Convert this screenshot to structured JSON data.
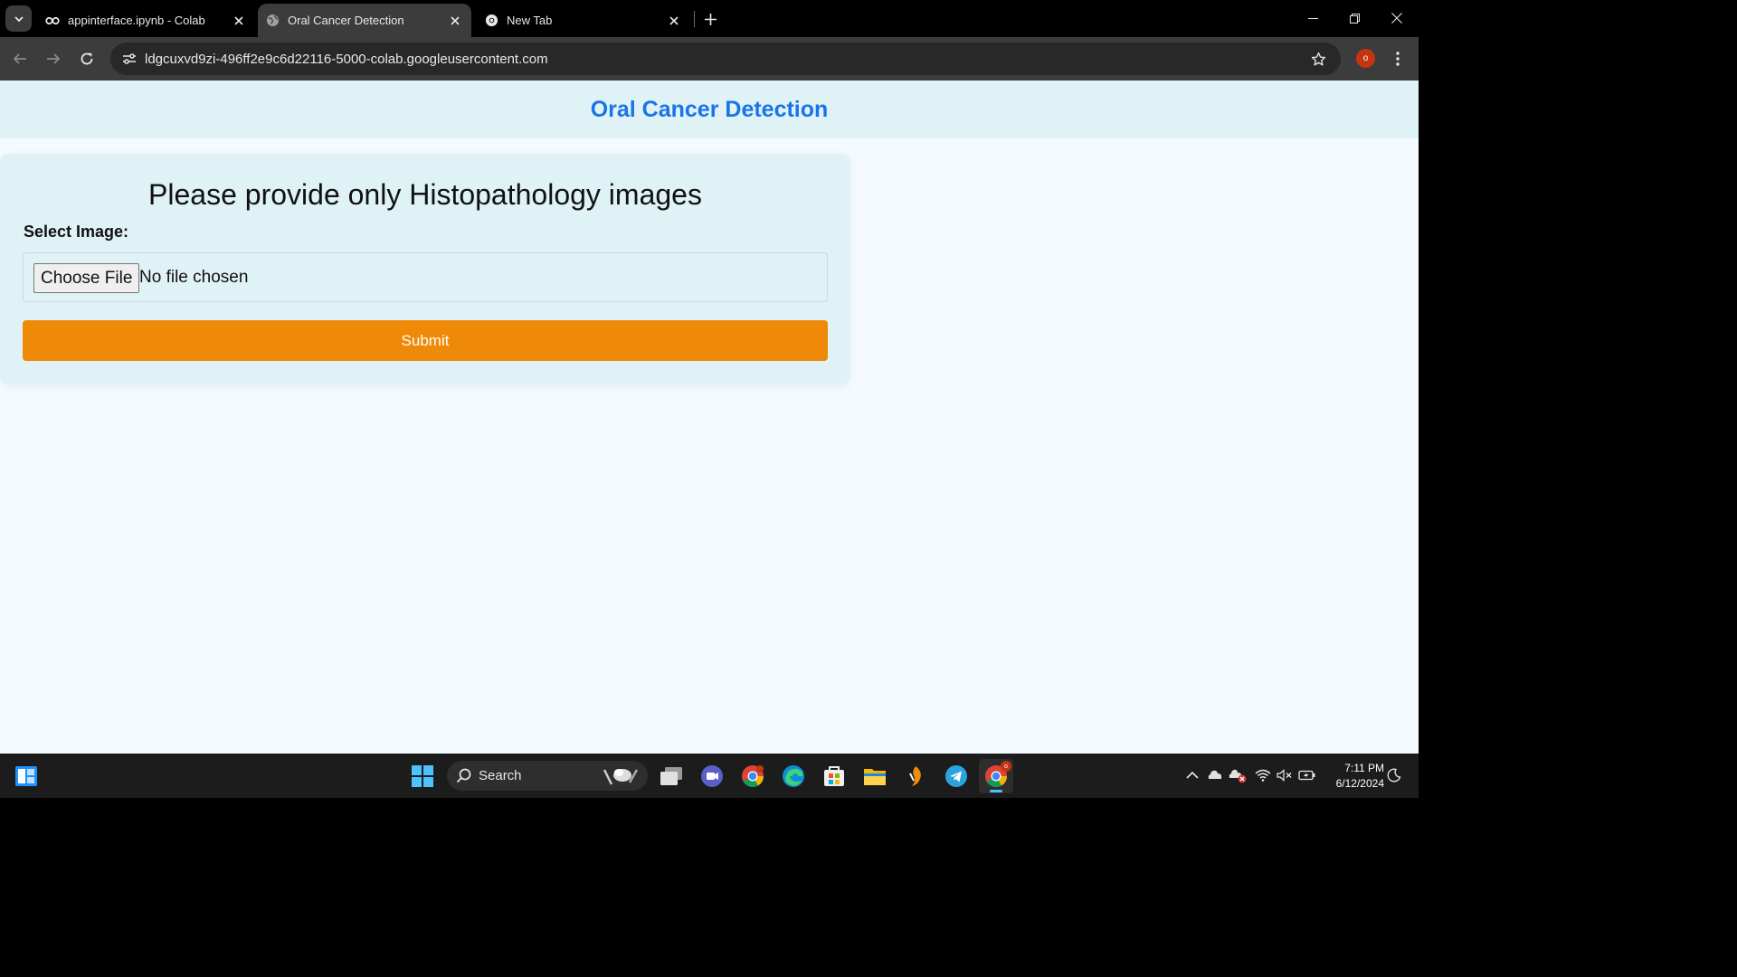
{
  "browser": {
    "tabs": [
      {
        "title": "appinterface.ipynb - Colab",
        "icon": "colab-icon"
      },
      {
        "title": "Oral Cancer Detection",
        "icon": "globe-icon",
        "active": true
      },
      {
        "title": "New Tab",
        "icon": "chrome-icon"
      }
    ],
    "url": "ldgcuxvd9zi-496ff2e9c6d22116-5000-colab.googleusercontent.com",
    "profile_initial": "o"
  },
  "page": {
    "site_title": "Oral Cancer Detection",
    "card_title": "Please provide only Histopathology images",
    "select_label": "Select Image:",
    "file_button": "Choose File",
    "file_status": "No file chosen",
    "submit_label": "Submit"
  },
  "taskbar": {
    "search_label": "Search",
    "chrome_badge": "o",
    "time": "7:11 PM",
    "date": "6/12/2024"
  },
  "colors": {
    "header_bg": "#dff2f6",
    "title_blue": "#1a73e8",
    "submit_orange": "#ee8a07",
    "page_bg": "#f4fafd"
  }
}
